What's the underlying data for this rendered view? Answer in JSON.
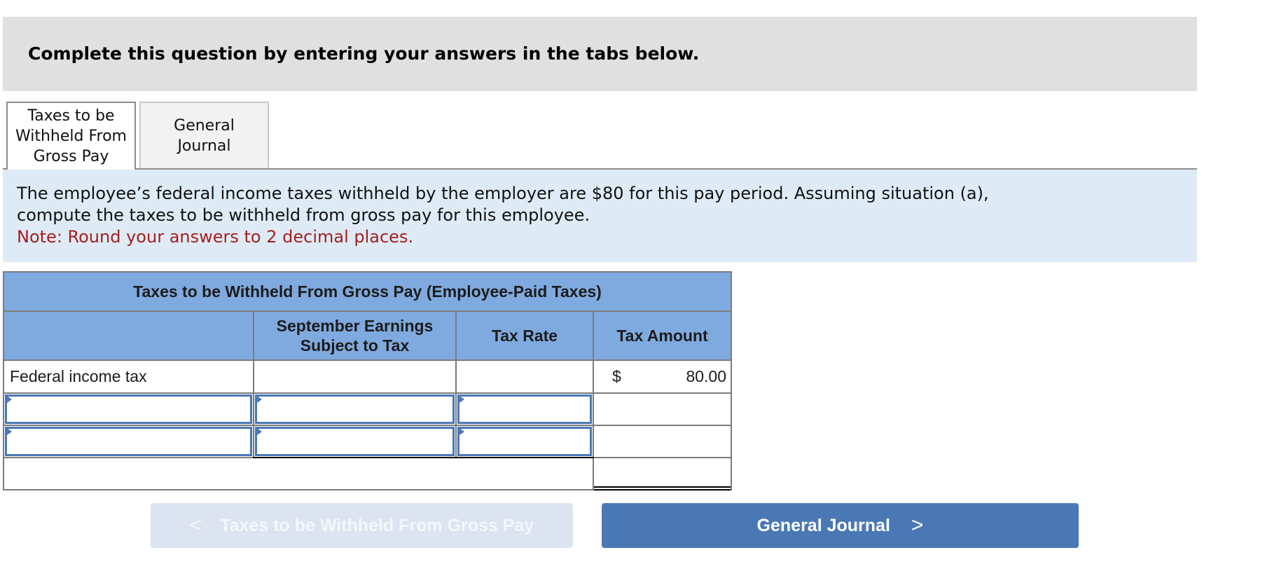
{
  "header": {
    "title": "Complete this question by entering your answers in the tabs below."
  },
  "tabs": [
    {
      "label_lines": [
        "Taxes to be",
        "Withheld From",
        "Gross Pay"
      ],
      "active": true
    },
    {
      "label_lines": [
        "General",
        "Journal"
      ],
      "active": false
    }
  ],
  "instructions": {
    "text": "The employee’s federal income taxes withheld by the employer are $80 for this pay period. Assuming situation (a), compute the taxes to be withheld from gross pay for this employee.",
    "note": "Note: Round your answers to 2 decimal places."
  },
  "table": {
    "title": "Taxes to be Withheld From Gross Pay (Employee-Paid Taxes)",
    "columns": [
      "",
      "September Earnings Subject to Tax",
      "Tax Rate",
      "Tax Amount"
    ],
    "column_header_lines": {
      "earnings": [
        "September Earnings",
        "Subject to Tax"
      ],
      "rate": "Tax Rate",
      "amount": "Tax Amount"
    },
    "rows": [
      {
        "label": "Federal income tax",
        "earnings": "",
        "rate": "",
        "currency": "$",
        "amount": "80.00"
      },
      {
        "label": "",
        "earnings": "",
        "rate": "",
        "amount": "",
        "editable": true
      },
      {
        "label": "",
        "earnings": "",
        "rate": "",
        "amount": "",
        "editable": true
      }
    ],
    "total": {
      "label": "",
      "amount": ""
    }
  },
  "navigation": {
    "prev_label": "Taxes to be Withheld From Gross Pay",
    "prev_icon": "chevron-left-icon",
    "prev_chevron": "<",
    "prev_disabled": true,
    "next_label": "General Journal",
    "next_icon": "chevron-right-icon",
    "next_chevron": ">"
  },
  "colors": {
    "header_bg": "#e0e0e0",
    "panel_bg": "#deebf7",
    "note_text": "#a5201c",
    "table_header_bg": "#7faadf",
    "input_border": "#4a78b5",
    "next_button_bg": "#4a78b5",
    "prev_button_bg": "#dbe4f0"
  }
}
